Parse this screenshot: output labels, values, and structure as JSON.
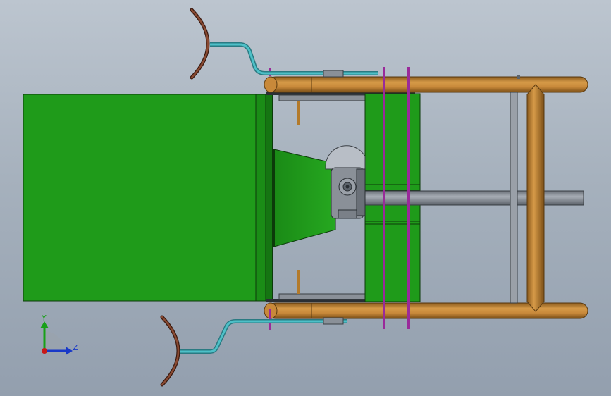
{
  "triad": {
    "y_label": "Y",
    "z_label": "Z",
    "y_color": "#18a018",
    "z_color": "#1838c8",
    "x_color": "#c81818"
  },
  "colors": {
    "hopper": "#1f9b1a",
    "hopper_dark": "#157512",
    "frame_tube": "#b37a2a",
    "frame_tube_light": "#d69a48",
    "coolant_pipe": "#3aa8b0",
    "bolt": "#9a2a9a",
    "steel": "#8a9098",
    "steel_dark": "#5c636b",
    "deflector": "#7a3a28"
  }
}
